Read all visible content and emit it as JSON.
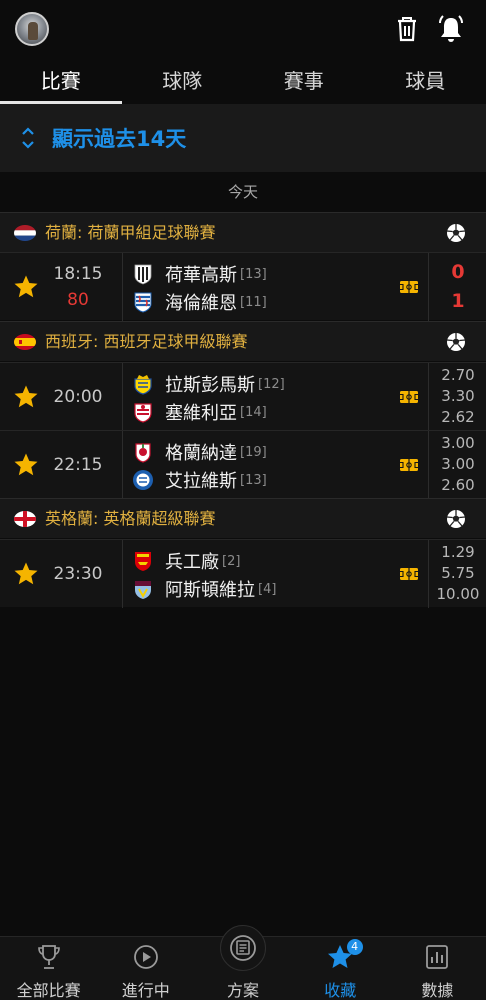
{
  "header": {
    "avatar_icon": "user-avatar",
    "trash_icon": "trash-icon",
    "bell_icon": "bell-icon"
  },
  "tabs": [
    {
      "label": "比賽",
      "active": true
    },
    {
      "label": "球隊",
      "active": false
    },
    {
      "label": "賽事",
      "active": false
    },
    {
      "label": "球員",
      "active": false
    }
  ],
  "past_banner": {
    "label": "顯示過去14天",
    "icon": "sort-arrows-icon"
  },
  "date_label": "今天",
  "colors": {
    "accent": "#1e90e8",
    "league_text": "#e0b040",
    "live": "#e53935",
    "star": "#f5b400"
  },
  "leagues": [
    {
      "name": "荷蘭: 荷蘭甲組足球聯賽",
      "flag": "netherlands-flag",
      "matches": [
        {
          "time": "18:15",
          "minute": "80",
          "home": {
            "name": "荷華高斯",
            "rank": "[13]"
          },
          "away": {
            "name": "海倫維恩",
            "rank": "[11]"
          },
          "score": [
            "0",
            "1"
          ]
        }
      ]
    },
    {
      "name": "西班牙: 西班牙足球甲級聯賽",
      "flag": "spain-flag",
      "matches": [
        {
          "time": "20:00",
          "home": {
            "name": "拉斯彭馬斯",
            "rank": "[12]"
          },
          "away": {
            "name": "塞維利亞",
            "rank": "[14]"
          },
          "odds": [
            "2.70",
            "3.30",
            "2.62"
          ]
        },
        {
          "time": "22:15",
          "home": {
            "name": "格蘭納達",
            "rank": "[19]"
          },
          "away": {
            "name": "艾拉維斯",
            "rank": "[13]"
          },
          "odds": [
            "3.00",
            "3.00",
            "2.60"
          ]
        }
      ]
    },
    {
      "name": "英格蘭: 英格蘭超級聯賽",
      "flag": "england-flag",
      "matches": [
        {
          "time": "23:30",
          "home": {
            "name": "兵工廠",
            "rank": "[2]"
          },
          "away": {
            "name": "阿斯頓維拉",
            "rank": "[4]"
          },
          "odds": [
            "1.29",
            "5.75",
            "10.00"
          ]
        }
      ]
    }
  ],
  "bottom_nav": [
    {
      "label": "全部比賽",
      "icon": "trophy-icon"
    },
    {
      "label": "進行中",
      "icon": "play-icon"
    },
    {
      "label": "方案",
      "icon": "plan-icon"
    },
    {
      "label": "收藏",
      "icon": "star-icon",
      "badge": "4",
      "active": true
    },
    {
      "label": "數據",
      "icon": "stats-icon"
    }
  ]
}
